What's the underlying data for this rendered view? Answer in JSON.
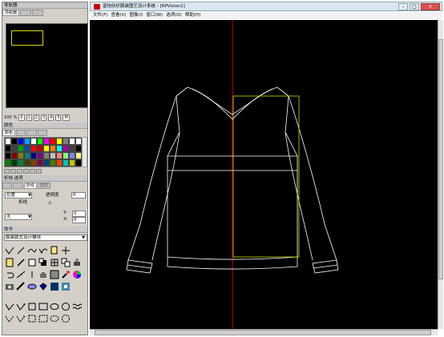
{
  "dock": {
    "navigator": {
      "title": "导航器",
      "tabs": [
        "导航器",
        "",
        ""
      ],
      "zoom": {
        "value": "100",
        "unit": "%",
        "levels": [
          "0",
          "1",
          "2",
          "3",
          "4",
          "5",
          "M"
        ]
      }
    },
    "color": {
      "title": "颜色",
      "tabs": [
        "颜色",
        "",
        "",
        ""
      ],
      "swatches": [
        "#ffffff",
        "#000000",
        "#0000ff",
        "#00a0ff",
        "#ffffff",
        "#00ff00",
        "#ff00ff",
        "#ff0000",
        "#ffff00",
        "#808080",
        "#ffffff",
        "#ffffff",
        "#000000",
        "#404040",
        "#00a000",
        "#0050a0",
        "#ff0000",
        "#c00000",
        "#ffff00",
        "#ff8000",
        "#00ffff",
        "#a000a0",
        "#404040",
        "#000000",
        "#000000",
        "#800000",
        "#808000",
        "#008080",
        "#000080",
        "#800080",
        "#808080",
        "#c0c0c0",
        "#ff8080",
        "#80ff80",
        "#8080ff",
        "#ffff80",
        "#008000",
        "#004000",
        "#008040",
        "#404000",
        "#804000",
        "#800040",
        "#004080",
        "#408000",
        "#ff4000",
        "#00c0c0",
        "#c0c000",
        "#000000"
      ]
    },
    "lines": {
      "title": "折线 选项",
      "tabs": [
        "",
        "",
        "折线",
        "选项"
      ],
      "position_value": "位置",
      "opacity_label": "透明度",
      "opacity_value": "0",
      "polyline_label": "折线",
      "type_value": "无",
      "x_label": "Y:",
      "y_label": "X:",
      "x_value": "0",
      "y_value": "0"
    },
    "command": {
      "title": "命令",
      "module_value": "服装款式设计模块"
    }
  },
  "window": {
    "title": "富怡纺织服装图艺设计系统 - [RPVision1]",
    "minimize": "–",
    "restore": "□",
    "close": "×",
    "menus": [
      "文件(F)",
      "查看(V)",
      "图像(I)",
      "窗口(W)",
      "选项(O)",
      "帮助(H)"
    ]
  },
  "colors": {
    "canvas_bg": "#000000",
    "garment_outline": "#ffffff",
    "center_guide": "#ff0000",
    "selection_box": "#d8d800"
  }
}
